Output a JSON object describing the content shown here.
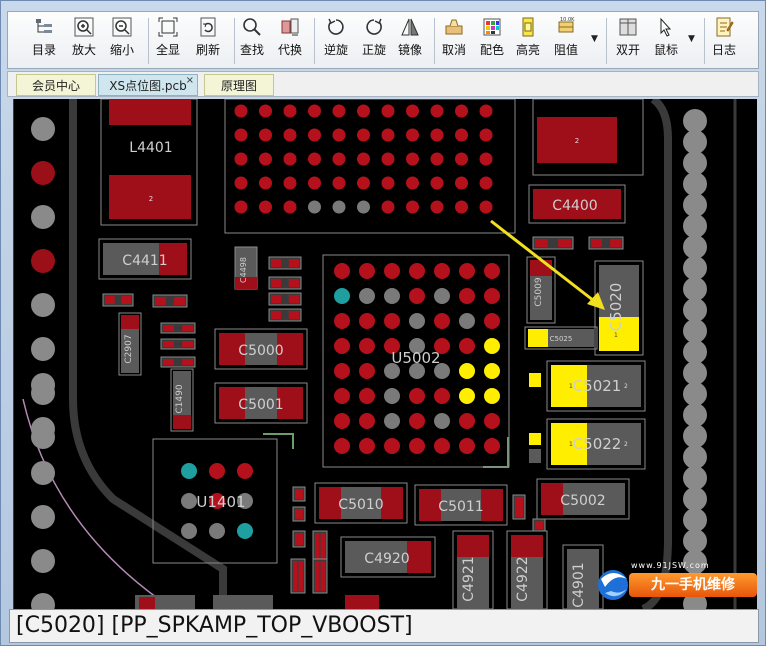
{
  "toolbar": {
    "buttons": [
      {
        "label": "目录",
        "icon": "tree-icon"
      },
      {
        "label": "放大",
        "icon": "zoom-in-icon"
      },
      {
        "label": "缩小",
        "icon": "zoom-out-icon"
      },
      {
        "label": "全显",
        "icon": "fit-icon"
      },
      {
        "label": "刷新",
        "icon": "refresh-icon"
      },
      {
        "label": "查找",
        "icon": "search-icon"
      },
      {
        "label": "代换",
        "icon": "replace-icon"
      },
      {
        "label": "逆旋",
        "icon": "rotate-ccw-icon"
      },
      {
        "label": "正旋",
        "icon": "rotate-cw-icon"
      },
      {
        "label": "镜像",
        "icon": "mirror-icon"
      },
      {
        "label": "取消",
        "icon": "cancel-icon"
      },
      {
        "label": "配色",
        "icon": "palette-icon"
      },
      {
        "label": "高亮",
        "icon": "highlight-icon"
      },
      {
        "label": "阻值",
        "icon": "resistor-icon"
      },
      {
        "label": "双开",
        "icon": "dual-window-icon"
      },
      {
        "label": "鼠标",
        "icon": "cursor-icon"
      },
      {
        "label": "日志",
        "icon": "log-icon"
      }
    ]
  },
  "tabs": [
    {
      "label": "会员中心"
    },
    {
      "label": "XS点位图.pcb",
      "close": "×"
    },
    {
      "label": "原理图"
    }
  ],
  "pcb": {
    "components": [
      "L4401",
      "C4411",
      "C4400",
      "C4498",
      "C2907",
      "C5000",
      "C5001",
      "U5002",
      "C5009",
      "C5020",
      "C5025",
      "C5021",
      "C5022",
      "C1490",
      "U1401",
      "C5010",
      "C5011",
      "C5002",
      "C4920",
      "C4921",
      "C4922",
      "C4901"
    ],
    "pad_labels": [
      "2",
      "2",
      "2",
      "1",
      "2",
      "1",
      "2"
    ],
    "highlight_color": "#ffee00",
    "pad_color": "#9e0f1a",
    "trace_color": "#3c3c3c"
  },
  "status": {
    "text": "[C5020] [PP_SPKAMP_TOP_VBOOST]"
  },
  "watermark": {
    "site": "www.91JSW.com",
    "text": "九一手机维修"
  }
}
